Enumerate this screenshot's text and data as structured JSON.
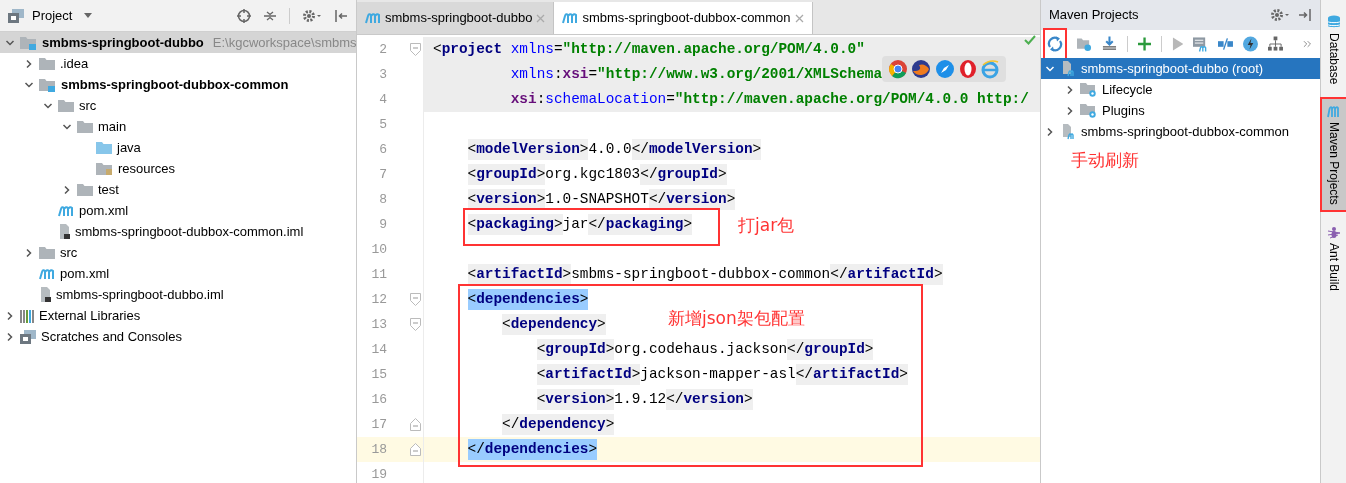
{
  "project_panel": {
    "title": "Project",
    "tree": [
      {
        "label": "smbms-springboot-dubbo",
        "hint": "E:\\kgcworkspace\\smbms",
        "kind": "module",
        "bold": true,
        "expanded": true,
        "selected": true,
        "children": [
          {
            "label": ".idea",
            "kind": "folder",
            "bold": false,
            "expanded": false,
            "selected": false
          },
          {
            "label": "smbms-springboot-dubbox-common",
            "kind": "module",
            "bold": true,
            "expanded": true,
            "selected": false,
            "children": [
              {
                "label": "src",
                "kind": "folder",
                "bold": false,
                "expanded": true,
                "selected": false,
                "children": [
                  {
                    "label": "main",
                    "kind": "folder",
                    "bold": false,
                    "expanded": true,
                    "selected": false,
                    "children": [
                      {
                        "label": "java",
                        "kind": "source",
                        "bold": false,
                        "selected": false
                      },
                      {
                        "label": "resources",
                        "kind": "resources",
                        "bold": false,
                        "selected": false
                      }
                    ]
                  },
                  {
                    "label": "test",
                    "kind": "folder",
                    "bold": false,
                    "expanded": false,
                    "selected": false
                  }
                ]
              },
              {
                "label": "pom.xml",
                "kind": "maven",
                "bold": false,
                "selected": false
              },
              {
                "label": "smbms-springboot-dubbox-common.iml",
                "kind": "iml",
                "bold": false,
                "selected": false
              }
            ]
          },
          {
            "label": "src",
            "kind": "folder",
            "bold": false,
            "expanded": false,
            "selected": false
          },
          {
            "label": "pom.xml",
            "kind": "maven",
            "bold": false,
            "selected": false
          },
          {
            "label": "smbms-springboot-dubbo.iml",
            "kind": "iml",
            "bold": false,
            "selected": false
          }
        ]
      },
      {
        "label": "External Libraries",
        "kind": "libraries",
        "bold": false,
        "expanded": false,
        "selected": false
      },
      {
        "label": "Scratches and Consoles",
        "kind": "scratches",
        "bold": false,
        "expanded": false,
        "selected": false
      }
    ]
  },
  "editor": {
    "tabs": [
      {
        "label": "smbms-springboot-dubbo",
        "selected": false
      },
      {
        "label": "smbms-springboot-dubbox-common",
        "selected": true
      }
    ],
    "lines": [
      {
        "number": "2",
        "shaded": true,
        "current": false,
        "fold": {
          "kind": "start"
        },
        "parts": [
          {
            "kind": "tag",
            "open": "<",
            "name": "project"
          },
          {
            "kind": "attr",
            "text": "xmlns"
          },
          {
            "kind": "punct",
            "text": "="
          },
          {
            "kind": "value",
            "text": "\"http://maven.apache.org/POM/4.0.0\""
          }
        ],
        "continuation": [
          {
            "number": "3",
            "shaded": true,
            "current": false,
            "parts": [
              {
                "kind": "attr",
                "text": "xmlns"
              },
              {
                "kind": "punct",
                "text": ":"
              },
              {
                "kind": "ns",
                "text": "xsi"
              },
              {
                "kind": "punct",
                "text": "="
              },
              {
                "kind": "value",
                "text": "\"http://www.w3.org/2001/XMLSchema"
              },
              {
                "kind": "popup"
              }
            ]
          },
          {
            "number": "4",
            "shaded": true,
            "current": false,
            "parts": [
              {
                "kind": "ns",
                "text": "xsi"
              },
              {
                "kind": "punct",
                "text": ":"
              },
              {
                "kind": "attr",
                "text": "schemaLocation"
              },
              {
                "kind": "punct",
                "text": "="
              },
              {
                "kind": "value",
                "text": "\"http://maven.apache.org/POM/4.0.0 http:/"
              }
            ]
          }
        ],
        "children": [
          {
            "number": "5",
            "shaded": false,
            "current": false
          },
          {
            "number": "6",
            "shaded": false,
            "current": false,
            "parts": [
              {
                "kind": "tag",
                "open": "<",
                "name": "modelVersion",
                "close": ">",
                "matched": false
              },
              {
                "kind": "text",
                "text": "4.0.0"
              },
              {
                "kind": "tag",
                "open": "</",
                "name": "modelVersion",
                "close": ">",
                "matched": false
              }
            ]
          },
          {
            "number": "7",
            "shaded": false,
            "current": false,
            "parts": [
              {
                "kind": "tag",
                "open": "<",
                "name": "groupId",
                "close": ">",
                "matched": false
              },
              {
                "kind": "text",
                "text": "org.kgc1803"
              },
              {
                "kind": "tag",
                "open": "</",
                "name": "groupId",
                "close": ">",
                "matched": false
              }
            ]
          },
          {
            "number": "8",
            "shaded": false,
            "current": false,
            "parts": [
              {
                "kind": "tag",
                "open": "<",
                "name": "version",
                "close": ">",
                "matched": false
              },
              {
                "kind": "text",
                "text": "1.0-SNAPSHOT"
              },
              {
                "kind": "tag",
                "open": "</",
                "name": "version",
                "close": ">",
                "matched": false
              }
            ]
          },
          {
            "number": "9",
            "shaded": false,
            "current": false,
            "parts": [
              {
                "kind": "tag",
                "open": "<",
                "name": "packaging",
                "close": ">",
                "matched": false
              },
              {
                "kind": "text",
                "text": "jar"
              },
              {
                "kind": "tag",
                "open": "</",
                "name": "packaging",
                "close": ">",
                "matched": false
              }
            ]
          },
          {
            "number": "10",
            "shaded": false,
            "current": false
          },
          {
            "number": "11",
            "shaded": false,
            "current": false,
            "parts": [
              {
                "kind": "tag",
                "open": "<",
                "name": "artifactId",
                "close": ">",
                "matched": false
              },
              {
                "kind": "text",
                "text": "smbms-springboot-dubbox-common"
              },
              {
                "kind": "tag",
                "open": "</",
                "name": "artifactId",
                "close": ">",
                "matched": false
              }
            ]
          },
          {
            "number": "12",
            "shaded": false,
            "current": false,
            "fold": {
              "kind": "start"
            },
            "parts": [
              {
                "kind": "tag",
                "open": "<",
                "name": "dependencies",
                "close": ">",
                "matched": true
              }
            ],
            "children": [
              {
                "number": "13",
                "shaded": false,
                "current": false,
                "fold": {
                  "kind": "start"
                },
                "parts": [
                  {
                    "kind": "tag",
                    "open": "<",
                    "name": "dependency",
                    "close": ">",
                    "matched": false
                  }
                ],
                "children": [
                  {
                    "number": "14",
                    "shaded": false,
                    "current": false,
                    "parts": [
                      {
                        "kind": "tag",
                        "open": "<",
                        "name": "groupId",
                        "close": ">",
                        "matched": false
                      },
                      {
                        "kind": "text",
                        "text": "org.codehaus.jackson"
                      },
                      {
                        "kind": "tag",
                        "open": "</",
                        "name": "groupId",
                        "close": ">",
                        "matched": false
                      }
                    ]
                  },
                  {
                    "number": "15",
                    "shaded": false,
                    "current": false,
                    "parts": [
                      {
                        "kind": "tag",
                        "open": "<",
                        "name": "artifactId",
                        "close": ">",
                        "matched": false
                      },
                      {
                        "kind": "text",
                        "text": "jackson-mapper-asl"
                      },
                      {
                        "kind": "tag",
                        "open": "</",
                        "name": "artifactId",
                        "close": ">",
                        "matched": false
                      }
                    ]
                  },
                  {
                    "number": "16",
                    "shaded": false,
                    "current": false,
                    "parts": [
                      {
                        "kind": "tag",
                        "open": "<",
                        "name": "version",
                        "close": ">",
                        "matched": false
                      },
                      {
                        "kind": "text",
                        "text": "1.9.12"
                      },
                      {
                        "kind": "tag",
                        "open": "</",
                        "name": "version",
                        "close": ">",
                        "matched": false
                      }
                    ]
                  }
                ]
              },
              {
                "number": "17",
                "shaded": false,
                "current": false,
                "fold": {
                  "kind": "end"
                },
                "parts": [
                  {
                    "kind": "tag",
                    "open": "</",
                    "name": "dependency",
                    "close": ">",
                    "matched": false
                  }
                ]
              }
            ]
          },
          {
            "number": "18",
            "shaded": false,
            "current": true,
            "fold": {
              "kind": "end"
            },
            "parts": [
              {
                "kind": "tag",
                "open": "</",
                "name": "dependencies",
                "close": ">",
                "matched": true
              }
            ]
          },
          {
            "number": "19",
            "shaded": false,
            "current": false
          }
        ]
      }
    ],
    "annotations": [
      {
        "text": "打jar包"
      },
      {
        "text": "新增json架包配置"
      }
    ]
  },
  "maven_panel": {
    "title": "Maven Projects",
    "annotation": "手动刷新",
    "tree": [
      {
        "label": "smbms-springboot-dubbo (root)",
        "kind": "project",
        "expanded": true,
        "selected": true,
        "children": [
          {
            "label": "Lifecycle",
            "kind": "group",
            "expanded": false,
            "selected": false
          },
          {
            "label": "Plugins",
            "kind": "group",
            "expanded": false,
            "selected": false
          }
        ]
      },
      {
        "label": "smbms-springboot-dubbox-common",
        "kind": "project",
        "expanded": false,
        "selected": false
      }
    ]
  },
  "side_tabs": [
    {
      "label": "Database",
      "kind": "database",
      "selected": false
    },
    {
      "label": "Maven Projects",
      "kind": "maven",
      "selected": true
    },
    {
      "label": "Ant Build",
      "kind": "ant",
      "selected": false
    }
  ]
}
